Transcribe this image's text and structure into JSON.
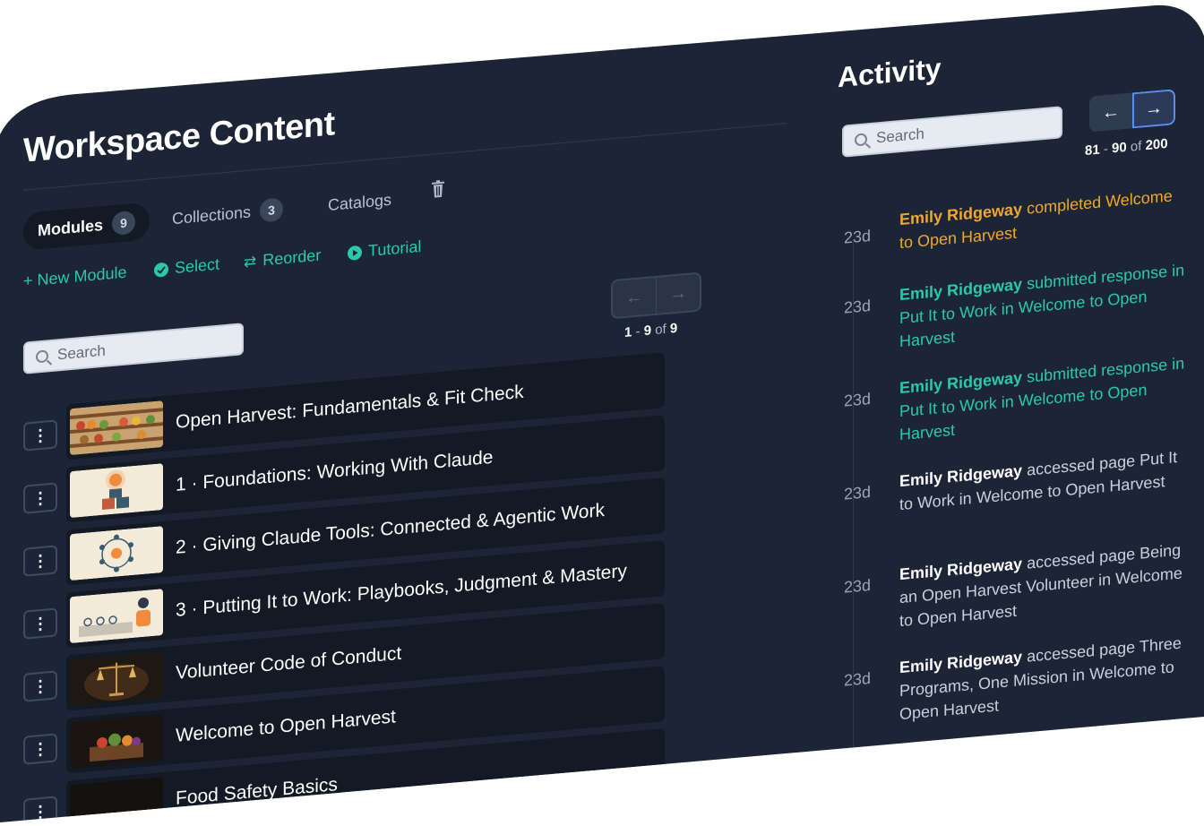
{
  "workspace": {
    "title": "Workspace Content",
    "tabs": [
      {
        "label": "Modules",
        "count": "9"
      },
      {
        "label": "Collections",
        "count": "3"
      },
      {
        "label": "Catalogs"
      }
    ],
    "actions": {
      "new_module": "+ New Module",
      "select": "Select",
      "reorder": "Reorder",
      "tutorial": "Tutorial"
    },
    "search": {
      "placeholder": "Search"
    },
    "pager": {
      "start": "1",
      "end": "9",
      "of_label": "of",
      "total": "9",
      "prev_icon": "←",
      "next_icon": "→"
    },
    "modules": [
      {
        "title": "Open Harvest: Fundamentals & Fit Check",
        "thumb": "market-shelves"
      },
      {
        "title": "1 · Foundations: Working With Claude",
        "thumb": "lightbulb-blocks"
      },
      {
        "title": "2 · Giving Claude Tools: Connected & Agentic Work",
        "thumb": "network-hub"
      },
      {
        "title": "3 · Putting It to Work: Playbooks, Judgment & Mastery",
        "thumb": "person-desk"
      },
      {
        "title": "Volunteer Code of Conduct",
        "thumb": "scales"
      },
      {
        "title": "Welcome to Open Harvest",
        "thumb": "vegetable-crate"
      },
      {
        "title": "Food Safety Basics",
        "thumb": "dark"
      }
    ],
    "kebab_icon": "⋮"
  },
  "activity": {
    "title": "Activity",
    "search": {
      "placeholder": "Search"
    },
    "pager": {
      "start": "81",
      "end": "90",
      "of_label": "of",
      "total": "200",
      "prev_icon": "←",
      "next_icon": "→"
    },
    "items": [
      {
        "age": "23d",
        "user": "Emily Ridgeway",
        "text": " completed Welcome to Open Harvest",
        "tone": "amber"
      },
      {
        "age": "23d",
        "user": "Emily Ridgeway",
        "text": " submitted response in Put It to Work in Welcome to Open Harvest",
        "tone": "teal"
      },
      {
        "age": "23d",
        "user": "Emily Ridgeway",
        "text": " submitted response in Put It to Work in Welcome to Open Harvest",
        "tone": "teal"
      },
      {
        "age": "23d",
        "user": "Emily Ridgeway",
        "text": " accessed page Put It to Work in Welcome to Open Harvest",
        "tone": "plain"
      },
      {
        "age": "23d",
        "user": "Emily Ridgeway",
        "text": " accessed page Being an Open Harvest Volunteer in Welcome to Open Harvest",
        "tone": "plain"
      },
      {
        "age": "23d",
        "user": "Emily Ridgeway",
        "text": " accessed page Three Programs, One Mission in Welcome to Open Harvest",
        "tone": "plain"
      }
    ]
  },
  "colors": {
    "background": "#1c2536",
    "accent_teal": "#2bc9ac",
    "accent_amber": "#f0a72c",
    "row": "#131a26"
  }
}
